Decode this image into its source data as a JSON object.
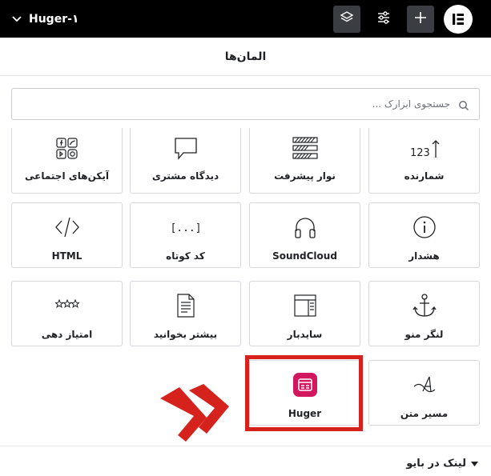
{
  "topbar": {
    "doc_title": "Huger-۱",
    "icons": [
      "chevron-down-icon",
      "layers-icon",
      "sliders-icon",
      "plus-icon",
      "elementor-logo-icon"
    ]
  },
  "panel": {
    "title": "المان‌ها"
  },
  "search": {
    "placeholder": "جستجوی ابزارک ..."
  },
  "widgets": {
    "row0": [
      "شمارنده",
      "نوار پیشرفت",
      "دیدگاه مشتری",
      "آیکن‌های اجتماعی"
    ],
    "row1": [
      "هشدار",
      "SoundCloud",
      "کد کوتاه",
      "HTML"
    ],
    "row2": [
      "لنگر منو",
      "سایدبار",
      "بیشتر بخوانید",
      "امتیاز دهی"
    ],
    "row3": [
      "مسیر متن",
      "Huger"
    ],
    "counter_icon_text": "123",
    "shortcode_icon_text": "[...]"
  },
  "section": {
    "label": "لینک در بایو"
  },
  "colors": {
    "accent": "#d5221d",
    "huger_brand": "#d3175f",
    "topbar": "#000000"
  }
}
